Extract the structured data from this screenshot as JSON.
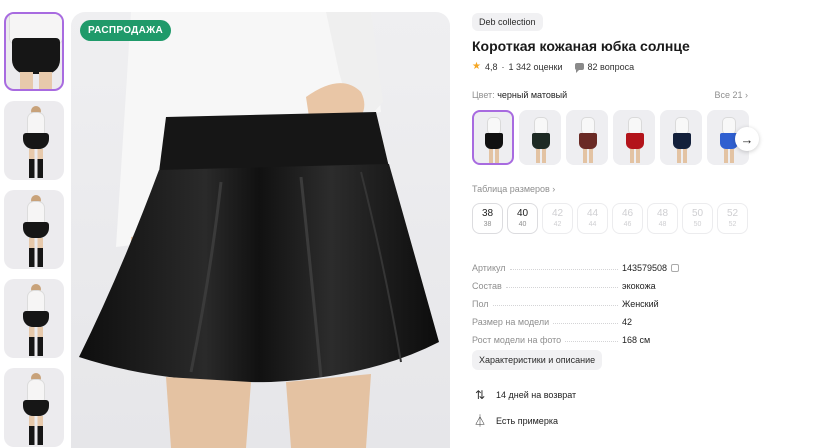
{
  "sale_badge": "РАСПРОДАЖА",
  "brand": "Deb collection",
  "product_title": "Короткая кожаная юбка солнце",
  "rating": {
    "score": "4,8",
    "reviews": "1 342 оценки",
    "questions": "82 вопроса",
    "star_icon": "star-icon",
    "questions_icon": "chat-icon"
  },
  "color": {
    "label": "Цвет:",
    "value": "черный матовый",
    "all_link": "Все 21 ›"
  },
  "swatches": [
    {
      "color": "#111111"
    },
    {
      "color": "#1e2a24"
    },
    {
      "color": "#6a2a25"
    },
    {
      "color": "#b3141b"
    },
    {
      "color": "#13203b"
    },
    {
      "color": "#2f5fd0"
    }
  ],
  "next_arrow": "→",
  "size_table": "Таблица размеров ›",
  "sizes": [
    {
      "size": "38",
      "ru": "38",
      "available": true
    },
    {
      "size": "40",
      "ru": "40",
      "available": true
    },
    {
      "size": "42",
      "ru": "42",
      "available": false
    },
    {
      "size": "44",
      "ru": "44",
      "available": false
    },
    {
      "size": "46",
      "ru": "46",
      "available": false
    },
    {
      "size": "48",
      "ru": "48",
      "available": false
    },
    {
      "size": "50",
      "ru": "50",
      "available": false
    },
    {
      "size": "52",
      "ru": "52",
      "available": false
    }
  ],
  "specs": [
    {
      "key": "Артикул",
      "value": "143579508"
    },
    {
      "key": "Состав",
      "value": "экокожа"
    },
    {
      "key": "Пол",
      "value": "Женский"
    },
    {
      "key": "Размер на модели",
      "value": "42"
    },
    {
      "key": "Рост модели на фото",
      "value": "168 см"
    }
  ],
  "characteristics_button": "Характеристики и описание",
  "perks": [
    {
      "icon": "return-arrows-icon",
      "text": "14 дней на возврат"
    },
    {
      "icon": "hanger-icon",
      "text": "Есть примерка"
    }
  ],
  "colors": {
    "sale_badge": "#1f9a6a",
    "active_border": "#a86be0",
    "star": "#f5a623"
  }
}
